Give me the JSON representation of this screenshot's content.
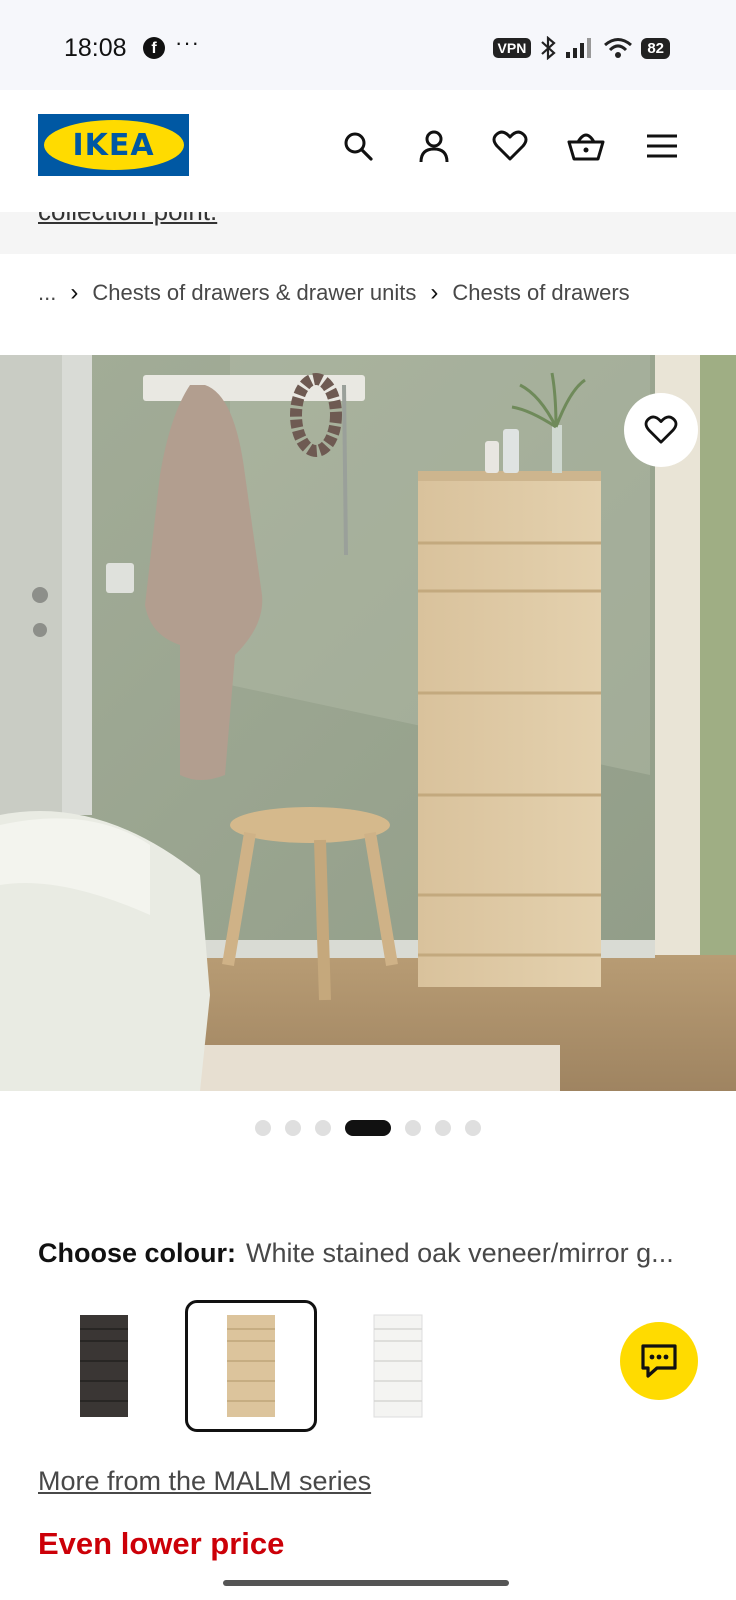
{
  "status_bar": {
    "time": "18:08",
    "vpn": "VPN",
    "battery": "82"
  },
  "header": {
    "logo_text": "IKEA",
    "brand_colors": {
      "blue": "#0058a3",
      "yellow": "#ffdb00"
    },
    "icons": [
      "search-icon",
      "profile-icon",
      "heart-icon",
      "basket-icon",
      "menu-icon"
    ]
  },
  "banner": {
    "text": "collection point."
  },
  "breadcrumb": {
    "ellipsis": "...",
    "items": [
      "Chests of drawers & drawer units",
      "Chests of drawers"
    ]
  },
  "gallery": {
    "image_count": 7,
    "active_index": 3
  },
  "colour": {
    "label": "Choose colour:",
    "value": "White stained oak veneer/mirror g..."
  },
  "series_link": "More from the MALM series",
  "price_label": "Even lower price",
  "accent_colors": {
    "price_red": "#cc0008",
    "chat_yellow": "#ffdb00"
  }
}
